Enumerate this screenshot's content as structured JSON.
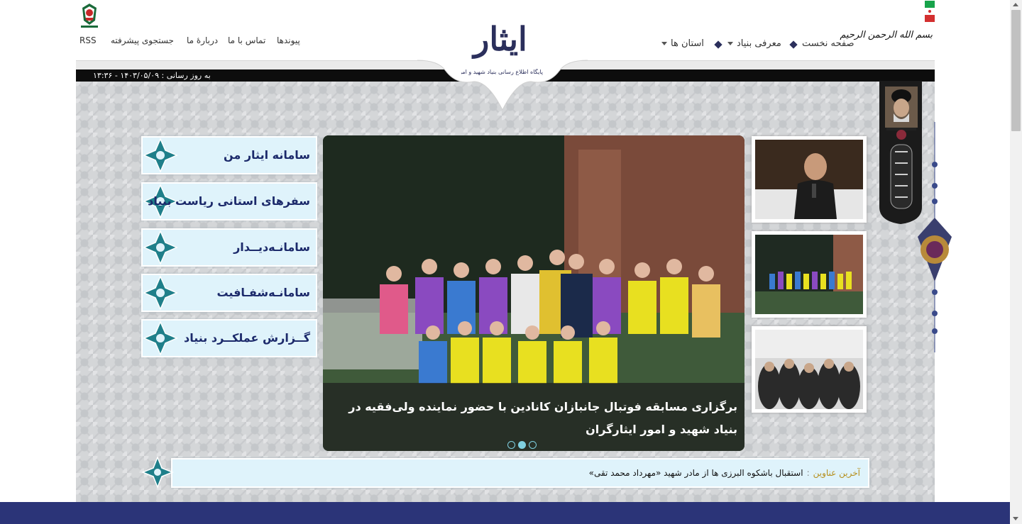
{
  "header": {
    "basmala": "بسم الله الرحمن الرحیم",
    "logo_title": "ایثار",
    "logo_subtitle": "پایگاه اطلاع رسانی بنیاد شهید و امور ایثارگران",
    "last_update": "به روز رسانی : ۱۴۰۳/۰۵/۰۹ - ۱۳:۳۶",
    "nav_right": [
      {
        "label": "صفحه نخست"
      },
      {
        "label": "معرفی بنیاد"
      },
      {
        "label": "استان ها"
      }
    ],
    "nav_left": [
      {
        "label": "پیوندها"
      },
      {
        "label": "تماس با ما"
      },
      {
        "label": "دربارهٔ ما"
      },
      {
        "label": "جستجوی پیشرفته"
      },
      {
        "label": "RSS"
      }
    ]
  },
  "sidebar": {
    "items": [
      {
        "label": "سامانه ایثار من"
      },
      {
        "label": "سفرهای استانی ریاست بنیاد"
      },
      {
        "label": "سامانـه‌دیــدار"
      },
      {
        "label": "سامانـه‌شفـافیت"
      },
      {
        "label": "گــزارش عملکــرد بنیاد"
      }
    ]
  },
  "slider": {
    "caption": "برگزاری مسابقه فوتبال جانبازان کانادین با حضور نماینده ولی‌فقیه در بنیاد شهید و امور ایثارگران",
    "slide_count": 3,
    "active_slide": 2
  },
  "ticker": {
    "label": "آخرین عناوین",
    "separator": ":",
    "headline": "استقبال باشکوه البرزی ها از مادر شهید «مهرداد محمد تقی»"
  },
  "colors": {
    "brand_navy": "#2b2f5c",
    "button_bg": "#dff3fb",
    "button_text": "#1c2a6b",
    "footer": "#2b3478",
    "ticker_label": "#b58e1a"
  }
}
